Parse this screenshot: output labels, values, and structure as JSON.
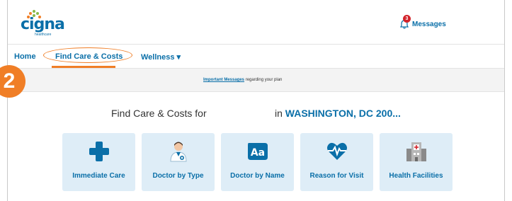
{
  "brand": {
    "name": "cigna",
    "sub": "healthcare"
  },
  "header": {
    "messages_label": "Messages",
    "messages_count": "3"
  },
  "nav": {
    "home": "Home",
    "find_care": "Find Care & Costs",
    "wellness": "Wellness ▾"
  },
  "banner": {
    "link": "Important Messages",
    "text": " regarding your plan"
  },
  "step_number": "2",
  "find": {
    "title": "Find Care & Costs for",
    "in_text": "in ",
    "location": "WASHINGTON, DC 200..."
  },
  "tiles": [
    {
      "label": "Immediate Care",
      "icon": "medical-cross-icon"
    },
    {
      "label": "Doctor by Type",
      "icon": "doctor-icon"
    },
    {
      "label": "Doctor by Name",
      "icon": "text-aa-icon"
    },
    {
      "label": "Reason for Visit",
      "icon": "heartbeat-icon"
    },
    {
      "label": "Health Facilities",
      "icon": "hospital-building-icon"
    }
  ],
  "colors": {
    "brand_blue": "#0a6fa8",
    "accent_orange": "#f07e26",
    "tile_bg": "#deedf7",
    "badge_red": "#d2232a"
  }
}
